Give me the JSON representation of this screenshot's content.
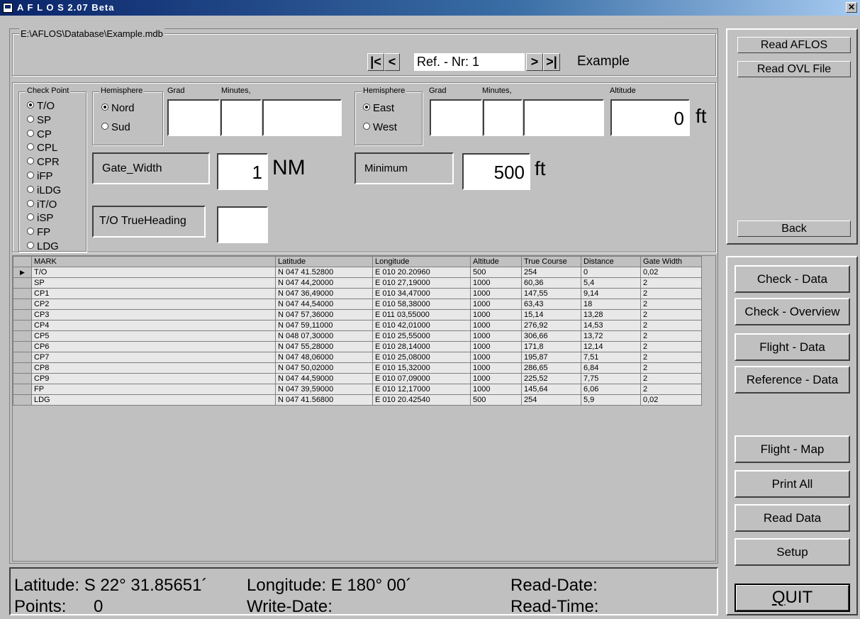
{
  "window": {
    "title": "A F L O S  2.07 Beta",
    "close_label": "✕"
  },
  "file": {
    "path": "E:\\AFLOS\\Database\\Example.mdb"
  },
  "navigator": {
    "first": "|<",
    "prev": "<",
    "ref_value": "Ref. - Nr: 1",
    "next": ">",
    "last": ">|",
    "name": "Example"
  },
  "checkpoint": {
    "legend": "Check Point",
    "options": [
      "T/O",
      "SP",
      "CP",
      "CPL",
      "CPR",
      "iFP",
      "iLDG",
      "iT/O",
      "iSP",
      "FP",
      "LDG"
    ],
    "selected": "T/O"
  },
  "latitude": {
    "hemisphere_legend": "Hemisphere",
    "options": [
      "Nord",
      "Sud"
    ],
    "selected": "Nord",
    "grad_label": "Grad",
    "minutes_label": "Minutes,"
  },
  "longitude": {
    "hemisphere_legend": "Hemisphere",
    "options": [
      "East",
      "West"
    ],
    "selected": "East",
    "grad_label": "Grad",
    "minutes_label": "Minutes,"
  },
  "altitude": {
    "label": "Altitude",
    "value": "0",
    "unit": "ft"
  },
  "gate_width": {
    "label": "Gate_Width",
    "value": "1",
    "unit": "NM"
  },
  "minimum": {
    "label": "Minimum",
    "value": "500",
    "unit": "ft"
  },
  "heading": {
    "label": "T/O TrueHeading",
    "value": ""
  },
  "table": {
    "columns": [
      "MARK",
      "Latitude",
      "Longitude",
      "Altitude",
      "True Course",
      "Distance",
      "Gate Width"
    ],
    "rows": [
      [
        "T/O",
        "N 047 41.52800",
        "E 010 20.20960",
        "500",
        "254",
        "0",
        "0,02"
      ],
      [
        "SP",
        "N 047 44,20000",
        "E 010 27,19000",
        "1000",
        "60,36",
        "5,4",
        "2"
      ],
      [
        "CP1",
        "N 047 36,49000",
        "E 010 34,47000",
        "1000",
        "147,55",
        "9,14",
        "2"
      ],
      [
        "CP2",
        "N 047 44,54000",
        "E 010 58,38000",
        "1000",
        "63,43",
        "18",
        "2"
      ],
      [
        "CP3",
        "N 047 57,36000",
        "E 011 03,55000",
        "1000",
        "15,14",
        "13,28",
        "2"
      ],
      [
        "CP4",
        "N 047 59,11000",
        "E 010 42,01000",
        "1000",
        "276,92",
        "14,53",
        "2"
      ],
      [
        "CP5",
        "N 048 07,30000",
        "E 010 25,55000",
        "1000",
        "306,66",
        "13,72",
        "2"
      ],
      [
        "CP6",
        "N 047 55,28000",
        "E 010 28,14000",
        "1000",
        "171,8",
        "12,14",
        "2"
      ],
      [
        "CP7",
        "N 047 48,06000",
        "E 010 25,08000",
        "1000",
        "195,87",
        "7,51",
        "2"
      ],
      [
        "CP8",
        "N 047 50,02000",
        "E 010 15,32000",
        "1000",
        "286,65",
        "6,84",
        "2"
      ],
      [
        "CP9",
        "N 047 44,59000",
        "E 010 07,09000",
        "1000",
        "225,52",
        "7,75",
        "2"
      ],
      [
        "FP",
        "N 047 39,59000",
        "E 010 12,17000",
        "1000",
        "145,64",
        "6,06",
        "2"
      ],
      [
        "LDG",
        "N 047 41.56800",
        "E 010 20.42540",
        "500",
        "254",
        "5,9",
        "0,02"
      ]
    ],
    "current_row_marker": "▶"
  },
  "side_top": {
    "read_aflos": "Read AFLOS",
    "read_ovl": "Read OVL File",
    "back": "Back"
  },
  "side_bottom": {
    "buttons": [
      "Check - Data",
      "Check - Overview",
      "Flight - Data",
      "Reference - Data",
      "Flight - Map",
      "Print All",
      "Read Data",
      "Setup"
    ],
    "quit": "QUIT"
  },
  "status": {
    "latitude": "Latitude: S 22° 31.85651´",
    "longitude": "Longitude: E 180° 00´",
    "read_date": "Read-Date:",
    "points_label": "Points:",
    "points_value": "0",
    "write_date": "Write-Date:",
    "read_time": "Read-Time:"
  }
}
